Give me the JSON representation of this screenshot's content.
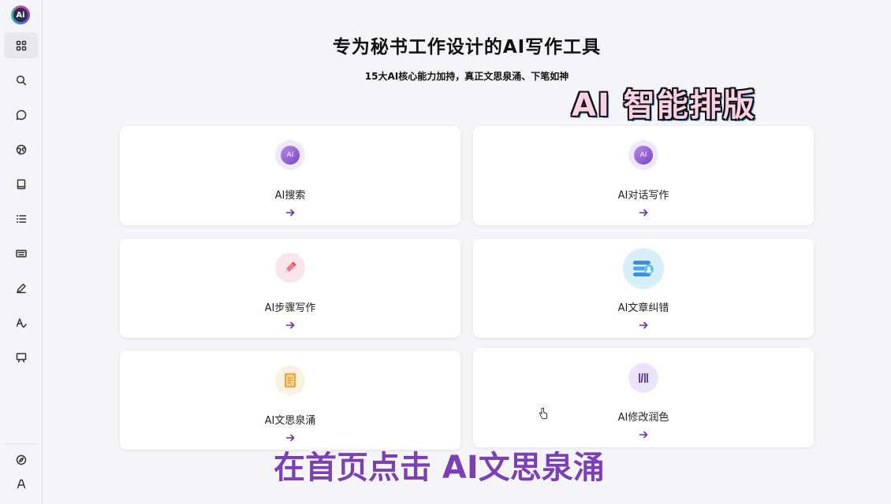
{
  "app": {
    "logo_text": "Ai"
  },
  "sidebar": {
    "items": [
      {
        "name": "dashboard",
        "icon": "grid-icon",
        "active": true
      },
      {
        "name": "search",
        "icon": "search-icon"
      },
      {
        "name": "chat",
        "icon": "chat-bubble-icon"
      },
      {
        "name": "globe",
        "icon": "globe-icon"
      },
      {
        "name": "book",
        "icon": "book-icon"
      },
      {
        "name": "list",
        "icon": "list-icon"
      },
      {
        "name": "keyboard",
        "icon": "keyboard-icon"
      },
      {
        "name": "edit",
        "icon": "pencil-icon"
      },
      {
        "name": "spell",
        "icon": "text-check-icon"
      },
      {
        "name": "presentation",
        "icon": "presentation-icon"
      }
    ],
    "bottom_items": [
      {
        "name": "explore",
        "icon": "compass-icon"
      },
      {
        "name": "account",
        "icon": "user-icon"
      }
    ]
  },
  "header": {
    "title": "专为秘书工作设计的AI写作工具",
    "subtitle": "15大AI核心能力加持，真正文思泉涌、下笔如神"
  },
  "cards": [
    {
      "label": "AI搜索",
      "icon": "ai-badge-icon"
    },
    {
      "label": "AI对话写作",
      "icon": "ai-badge-icon"
    },
    {
      "label": "AI步骤写作",
      "icon": "pen-icon"
    },
    {
      "label": "AI文章纠错",
      "icon": "document-check-icon"
    },
    {
      "label": "AI文思泉涌",
      "icon": "book-stack-icon"
    },
    {
      "label": "AI修改润色",
      "icon": "library-icon"
    }
  ],
  "overlay": {
    "badge": "AI 智能排版",
    "caption": "在首页点击 AI文思泉涌",
    "ai_icon_text": "AI"
  },
  "colors": {
    "accent": "#6b2fa8",
    "caption": "#7b3fb8",
    "background": "#f4f5f8"
  }
}
